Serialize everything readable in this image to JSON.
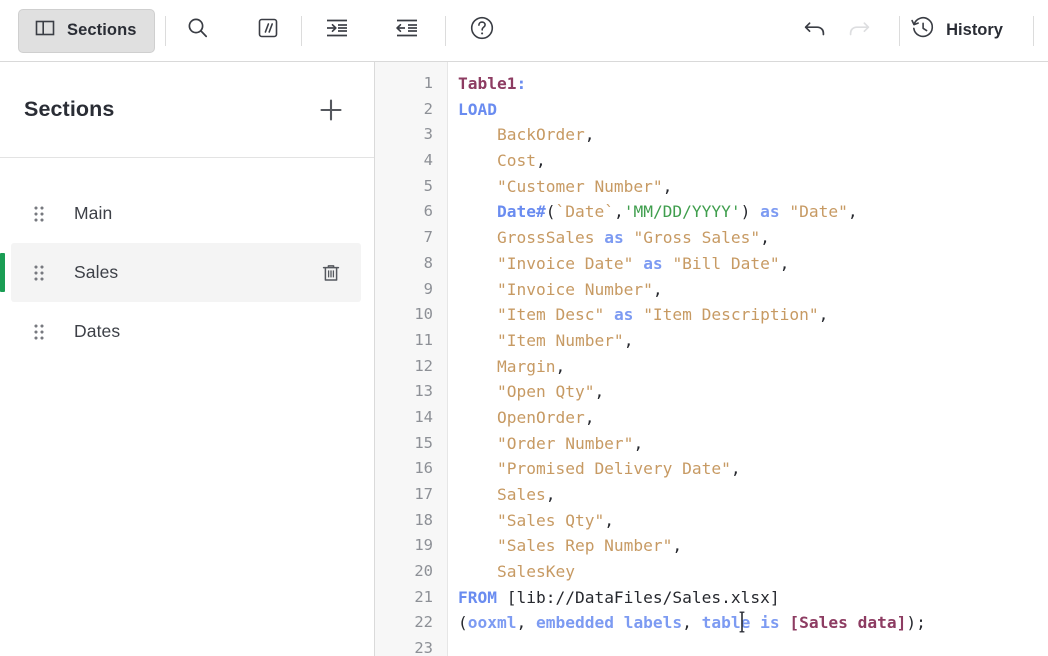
{
  "toolbar": {
    "sections_button": {
      "label": "Sections",
      "icon": "panel-layout-icon",
      "active": true
    },
    "search_icon": "search-icon",
    "comment_icon": "comment-slashes-icon",
    "indent_right_icon": "indent-increase-icon",
    "indent_left_icon": "indent-decrease-icon",
    "help_icon": "help-circle-icon",
    "undo": {
      "icon": "undo-arrow-icon",
      "enabled": true
    },
    "redo": {
      "icon": "redo-arrow-icon",
      "enabled": false
    },
    "history": {
      "label": "History",
      "icon": "history-clock-icon"
    }
  },
  "sidebar": {
    "title": "Sections",
    "add_icon": "plus-icon",
    "items": [
      {
        "label": "Main",
        "selected": false,
        "drag_icon": "drag-handle-icon",
        "delete_icon": "trash-icon"
      },
      {
        "label": "Sales",
        "selected": true,
        "drag_icon": "drag-handle-icon",
        "delete_icon": "trash-icon"
      },
      {
        "label": "Dates",
        "selected": false,
        "drag_icon": "drag-handle-icon",
        "delete_icon": "trash-icon"
      }
    ],
    "accent_color": "#1a9d54",
    "selected_bg": "#f4f4f4"
  },
  "editor": {
    "line_numbers": [
      "1",
      "2",
      "3",
      "4",
      "5",
      "6",
      "7",
      "8",
      "9",
      "10",
      "11",
      "12",
      "13",
      "14",
      "15",
      "16",
      "17",
      "18",
      "19",
      "20",
      "21",
      "22",
      "23"
    ],
    "lines": [
      {
        "n": 1,
        "text": "Table1:"
      },
      {
        "n": 2,
        "text": "LOAD"
      },
      {
        "n": 3,
        "text": "    BackOrder,"
      },
      {
        "n": 4,
        "text": "    Cost,"
      },
      {
        "n": 5,
        "text": "    \"Customer Number\","
      },
      {
        "n": 6,
        "text": "    Date#(`Date`,'MM/DD/YYYY') as \"Date\","
      },
      {
        "n": 7,
        "text": "    GrossSales as \"Gross Sales\","
      },
      {
        "n": 8,
        "text": "    \"Invoice Date\" as \"Bill Date\","
      },
      {
        "n": 9,
        "text": "    \"Invoice Number\","
      },
      {
        "n": 10,
        "text": "    \"Item Desc\" as \"Item Description\","
      },
      {
        "n": 11,
        "text": "    \"Item Number\","
      },
      {
        "n": 12,
        "text": "    Margin,"
      },
      {
        "n": 13,
        "text": "    \"Open Qty\","
      },
      {
        "n": 14,
        "text": "    OpenOrder,"
      },
      {
        "n": 15,
        "text": "    \"Order Number\","
      },
      {
        "n": 16,
        "text": "    \"Promised Delivery Date\","
      },
      {
        "n": 17,
        "text": "    Sales,"
      },
      {
        "n": 18,
        "text": "    \"Sales Qty\","
      },
      {
        "n": 19,
        "text": "    \"Sales Rep Number\","
      },
      {
        "n": 20,
        "text": "    SalesKey"
      },
      {
        "n": 21,
        "text": "FROM [lib://DataFiles/Sales.xlsx]"
      },
      {
        "n": 22,
        "text": "(ooxml, embedded labels, table is [Sales data]);"
      },
      {
        "n": 23,
        "text": ""
      }
    ],
    "colors": {
      "table_label": "#8d3c62",
      "keyword": "#6a8cf0",
      "field": "#c79a63",
      "string_literal": "#3f9e4d",
      "punctuation": "#26282e",
      "gutter_bg": "#f7f7f7",
      "gutter_text": "#8d9096"
    }
  }
}
